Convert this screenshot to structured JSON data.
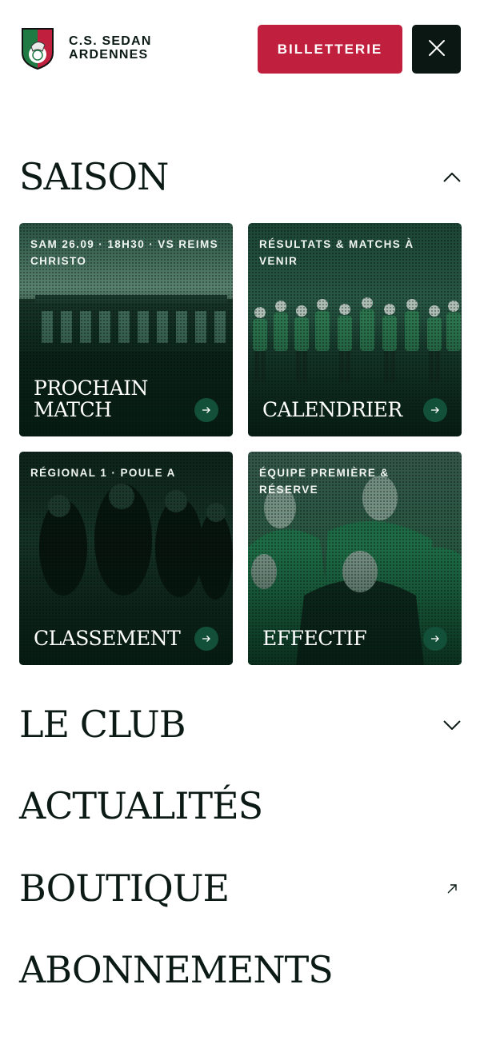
{
  "header": {
    "club_name_line1": "C.S. SEDAN",
    "club_name_line2": "ARDENNES",
    "ticket_button_label": "BILLETTERIE",
    "logo_icon": "club-crest-icon",
    "close_icon": "close-icon"
  },
  "colors": {
    "brand_red": "#c0203e",
    "dark": "#0a1712",
    "card_green": "#12503a"
  },
  "menu": {
    "saison": {
      "title": "SAISON",
      "expanded": true,
      "cards": [
        {
          "kicker": "SAM 26.09 · 18H30 · VS REIMS CHRISTO",
          "title_line1": "PROCHAIN",
          "title_line2": "MATCH"
        },
        {
          "kicker": "RÉSULTATS & MATCHS À VENIR",
          "title_line1": "CALENDRIER",
          "title_line2": ""
        },
        {
          "kicker": "RÉGIONAL 1 · POULE A",
          "title_line1": "CLASSEMENT",
          "title_line2": ""
        },
        {
          "kicker": "ÉQUIPE PREMIÈRE & RÉSERVE",
          "title_line1": "EFFECTIF",
          "title_line2": ""
        }
      ]
    },
    "le_club": {
      "title": "LE CLUB",
      "expanded": false
    },
    "actualites": {
      "title": "ACTUALITÉS"
    },
    "boutique": {
      "title": "BOUTIQUE",
      "icon": "external-link-icon"
    },
    "abonnements": {
      "title": "ABONNEMENTS"
    }
  }
}
